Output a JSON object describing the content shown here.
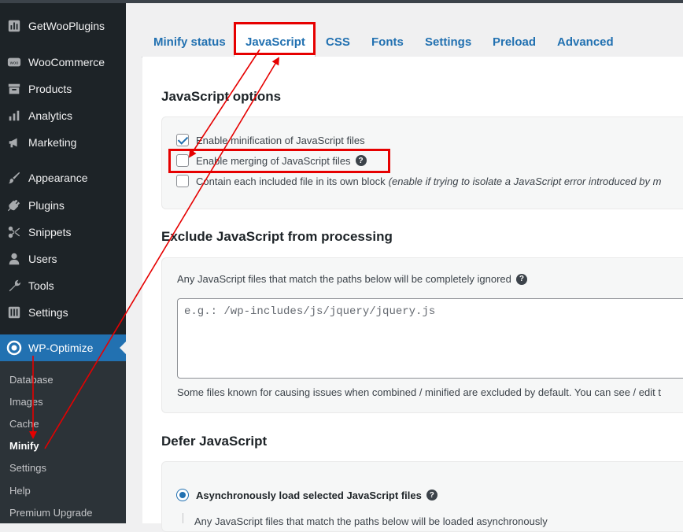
{
  "sidebar": {
    "items": [
      {
        "label": "GetWooPlugins",
        "icon": "getwoo-icon"
      },
      {
        "label": "WooCommerce",
        "icon": "woo-icon"
      },
      {
        "label": "Products",
        "icon": "archive-icon"
      },
      {
        "label": "Analytics",
        "icon": "bar-chart-icon"
      },
      {
        "label": "Marketing",
        "icon": "megaphone-icon"
      },
      {
        "label": "Appearance",
        "icon": "brush-icon"
      },
      {
        "label": "Plugins",
        "icon": "plug-icon"
      },
      {
        "label": "Snippets",
        "icon": "scissors-icon"
      },
      {
        "label": "Users",
        "icon": "user-icon"
      },
      {
        "label": "Tools",
        "icon": "wrench-icon"
      },
      {
        "label": "Settings",
        "icon": "sliders-icon"
      }
    ],
    "active": {
      "label": "WP-Optimize",
      "icon": "wp-optimize-icon"
    },
    "submenu": [
      "Database",
      "Images",
      "Cache",
      "Minify",
      "Settings",
      "Help",
      "Premium Upgrade"
    ],
    "submenu_current": "Minify"
  },
  "tabs": [
    "Minify status",
    "JavaScript",
    "CSS",
    "Fonts",
    "Settings",
    "Preload",
    "Advanced"
  ],
  "active_tab": "JavaScript",
  "js_options": {
    "heading": "JavaScript options",
    "enable_minify": {
      "label": "Enable minification of JavaScript files",
      "checked": true
    },
    "enable_merge": {
      "label": "Enable merging of JavaScript files",
      "checked": false
    },
    "contain_block": {
      "label": "Contain each included file in its own block",
      "note": "(enable if trying to isolate a JavaScript error introduced by m",
      "checked": false
    }
  },
  "exclude": {
    "heading": "Exclude JavaScript from processing",
    "description": "Any JavaScript files that match the paths below will be completely ignored",
    "placeholder": "e.g.: /wp-includes/js/jquery/jquery.js",
    "footnote": "Some files known for causing issues when combined / minified are excluded by default. You can see / edit t"
  },
  "defer": {
    "heading": "Defer JavaScript",
    "async_label": "Asynchronously load selected JavaScript files",
    "async_selected": true,
    "async_description": "Any JavaScript files that match the paths below will be loaded asynchronously"
  },
  "colors": {
    "accent": "#2271b1",
    "sidebar": "#1d2327",
    "annotation": "#e60000"
  }
}
